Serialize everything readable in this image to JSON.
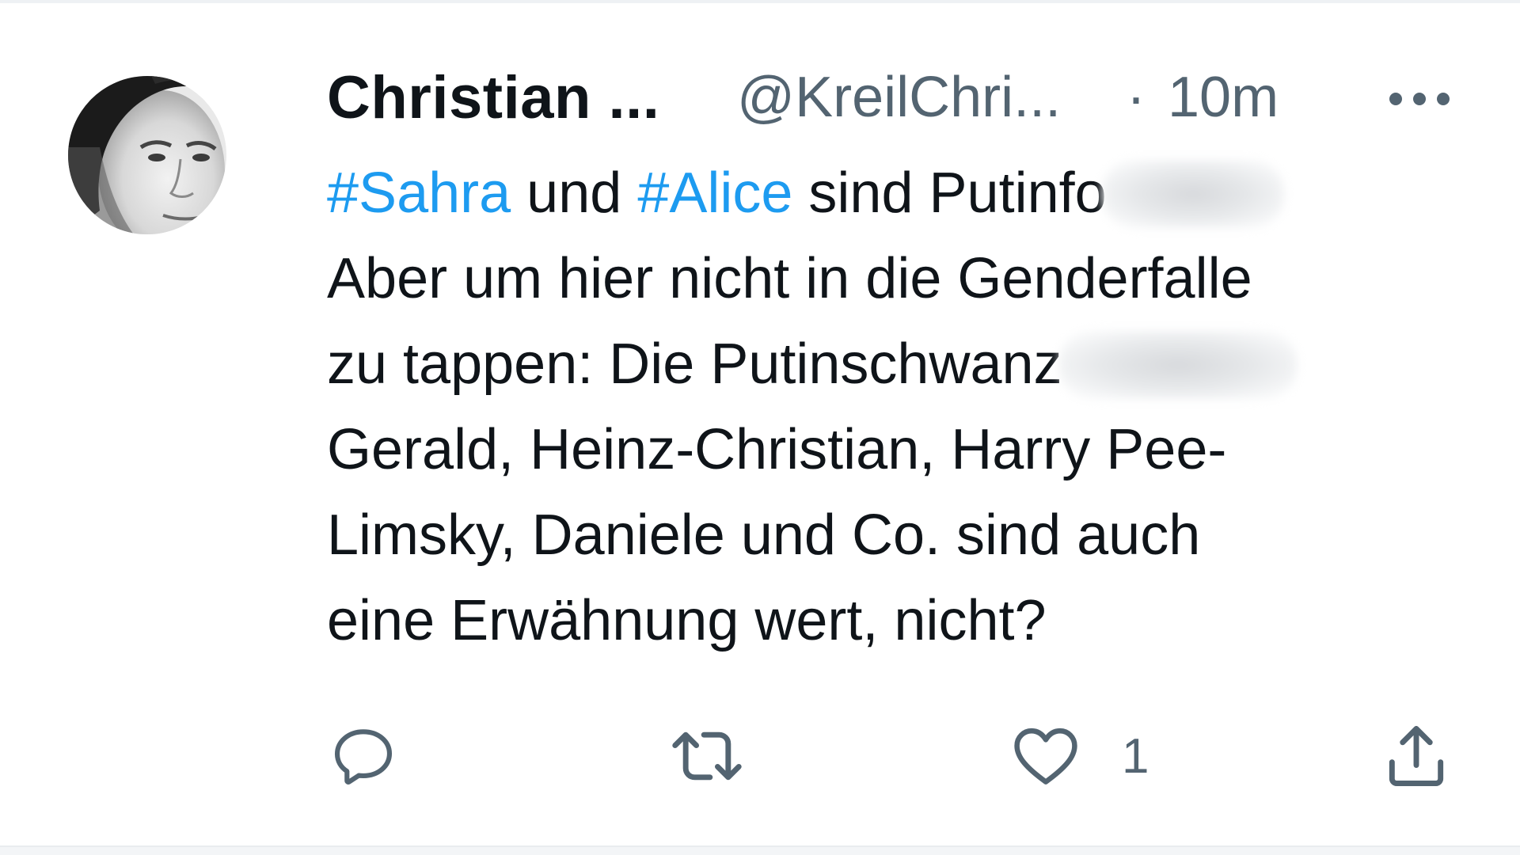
{
  "tweet": {
    "author": {
      "display_name": "Christian ...",
      "handle": "@KreilChri...",
      "avatar_icon": "profile-photo"
    },
    "separator": "·",
    "timestamp": "10m",
    "more_icon": "more-horizontal-icon",
    "body": {
      "lines": [
        {
          "hashtag_1": "#Sahra",
          "text_1": " und ",
          "hashtag_2": "#Alice",
          "text_2": " sind Putinfo"
        },
        {
          "text": "Aber um hier nicht in die Genderfalle"
        },
        {
          "text": "zu tappen: Die Putinschwanz"
        },
        {
          "text": "Gerald, Heinz-Christian, Harry Pee-"
        },
        {
          "text": "Limsky, Daniele und Co. sind auch"
        },
        {
          "text": "eine Erwähnung wert, nicht?"
        }
      ]
    },
    "actions": {
      "reply": {
        "icon": "reply-icon",
        "count": ""
      },
      "retweet": {
        "icon": "retweet-icon",
        "count": ""
      },
      "like": {
        "icon": "heart-icon",
        "count": "1"
      },
      "share": {
        "icon": "share-icon",
        "count": ""
      }
    }
  },
  "colors": {
    "text_primary": "#0f1419",
    "text_secondary": "#536471",
    "hashtag": "#1d9bf0",
    "background": "#ffffff"
  }
}
